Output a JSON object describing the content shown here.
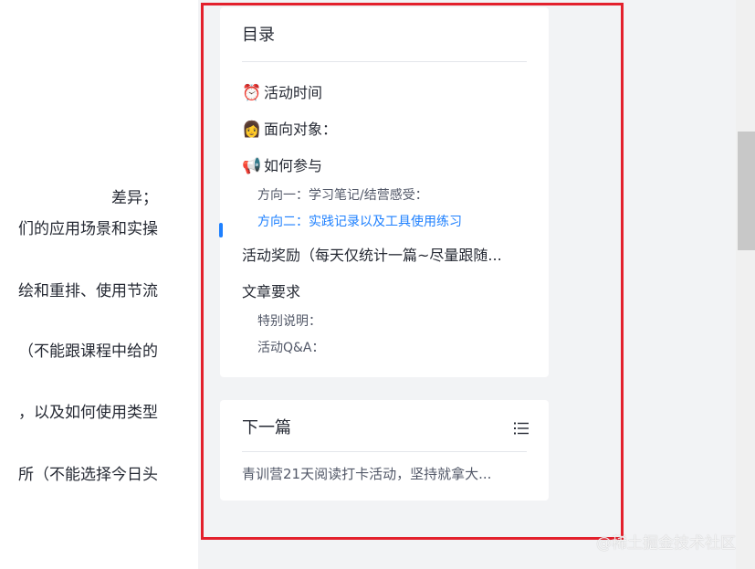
{
  "article": {
    "lines": [
      "差异；",
      "们的应用场景和实操",
      "绘和重排、使用节流",
      "（不能跟课程中给的",
      "，以及如何使用类型",
      "所（不能选择今日头"
    ]
  },
  "toc": {
    "title": "目录",
    "items": [
      {
        "emoji": "⏰",
        "label": "活动时间",
        "level": 1,
        "active": false
      },
      {
        "emoji": "👩",
        "label": "面向对象：",
        "level": 1,
        "active": false
      },
      {
        "emoji": "📢",
        "label": "如何参与",
        "level": 1,
        "active": false
      },
      {
        "emoji": "",
        "label": "方向一：学习笔记/结营感受：",
        "level": 2,
        "active": false
      },
      {
        "emoji": "",
        "label": "方向二：实践记录以及工具使用练习",
        "level": 2,
        "active": true
      },
      {
        "emoji": "",
        "label": "活动奖励（每天仅统计一篇~尽量跟随...",
        "level": 1,
        "active": false
      },
      {
        "emoji": "",
        "label": "文章要求",
        "level": 1,
        "active": false
      },
      {
        "emoji": "",
        "label": "特别说明：",
        "level": 2,
        "active": false
      },
      {
        "emoji": "",
        "label": "活动Q&A：",
        "level": 2,
        "active": false
      }
    ]
  },
  "next": {
    "title": "下一篇",
    "link": "青训营21天阅读打卡活动，坚持就拿大..."
  },
  "watermark": "@稀土掘金技术社区",
  "colors": {
    "accent": "#1e80ff",
    "highlight": "#e3202c",
    "text": "#252933",
    "muted": "#515767"
  }
}
